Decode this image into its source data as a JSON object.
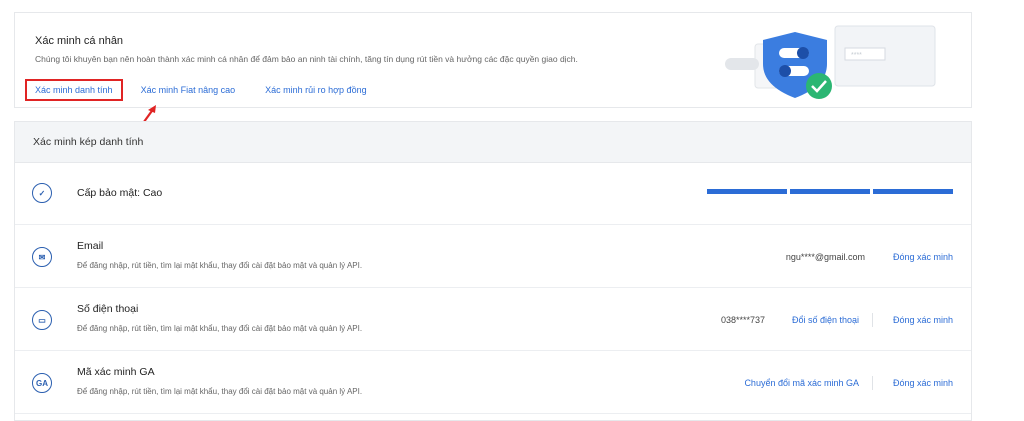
{
  "kyc": {
    "title": "Xác minh cá nhân",
    "description": "Chúng tôi khuyên bạn nên hoàn thành xác minh cá nhân để đảm bảo an ninh tài chính, tăng tín dụng rút tiền và hưởng các đặc quyền giao dịch.",
    "links": [
      "Xác minh danh tính",
      "Xác minh Fiat nâng cao",
      "Xác minh rủi ro hợp đồng"
    ]
  },
  "twofa": {
    "title": "Xác minh kép danh tính",
    "security": {
      "label": "Cấp bảo mật: Cao",
      "level_segments_filled": 3,
      "level_segments_total": 3
    },
    "email": {
      "title": "Email",
      "desc": "Để đăng nhập, rút tiền, tìm lại mật khẩu, thay đổi cài đặt bảo mật và quản lý API.",
      "value": "ngu****@gmail.com",
      "action": "Đóng xác minh"
    },
    "phone": {
      "title": "Số điện thoại",
      "desc": "Để đăng nhập, rút tiền, tìm lại mật khẩu, thay đổi cài đặt bảo mật và quản lý API.",
      "value": "038****737",
      "action_change": "Đổi số điện thoại",
      "action": "Đóng xác minh"
    },
    "ga": {
      "icon_text": "GA",
      "title": "Mã xác minh GA",
      "desc": "Để đăng nhập, rút tiền, tìm lại mật khẩu, thay đổi cài đặt bảo mật và quản lý API.",
      "action_change": "Chuyển đổi mã xác minh GA",
      "action": "Đóng xác minh"
    }
  },
  "colors": {
    "accent": "#2b6cd6",
    "highlight": "#e02424",
    "shield": "#3b7de0",
    "check": "#2bb673"
  }
}
